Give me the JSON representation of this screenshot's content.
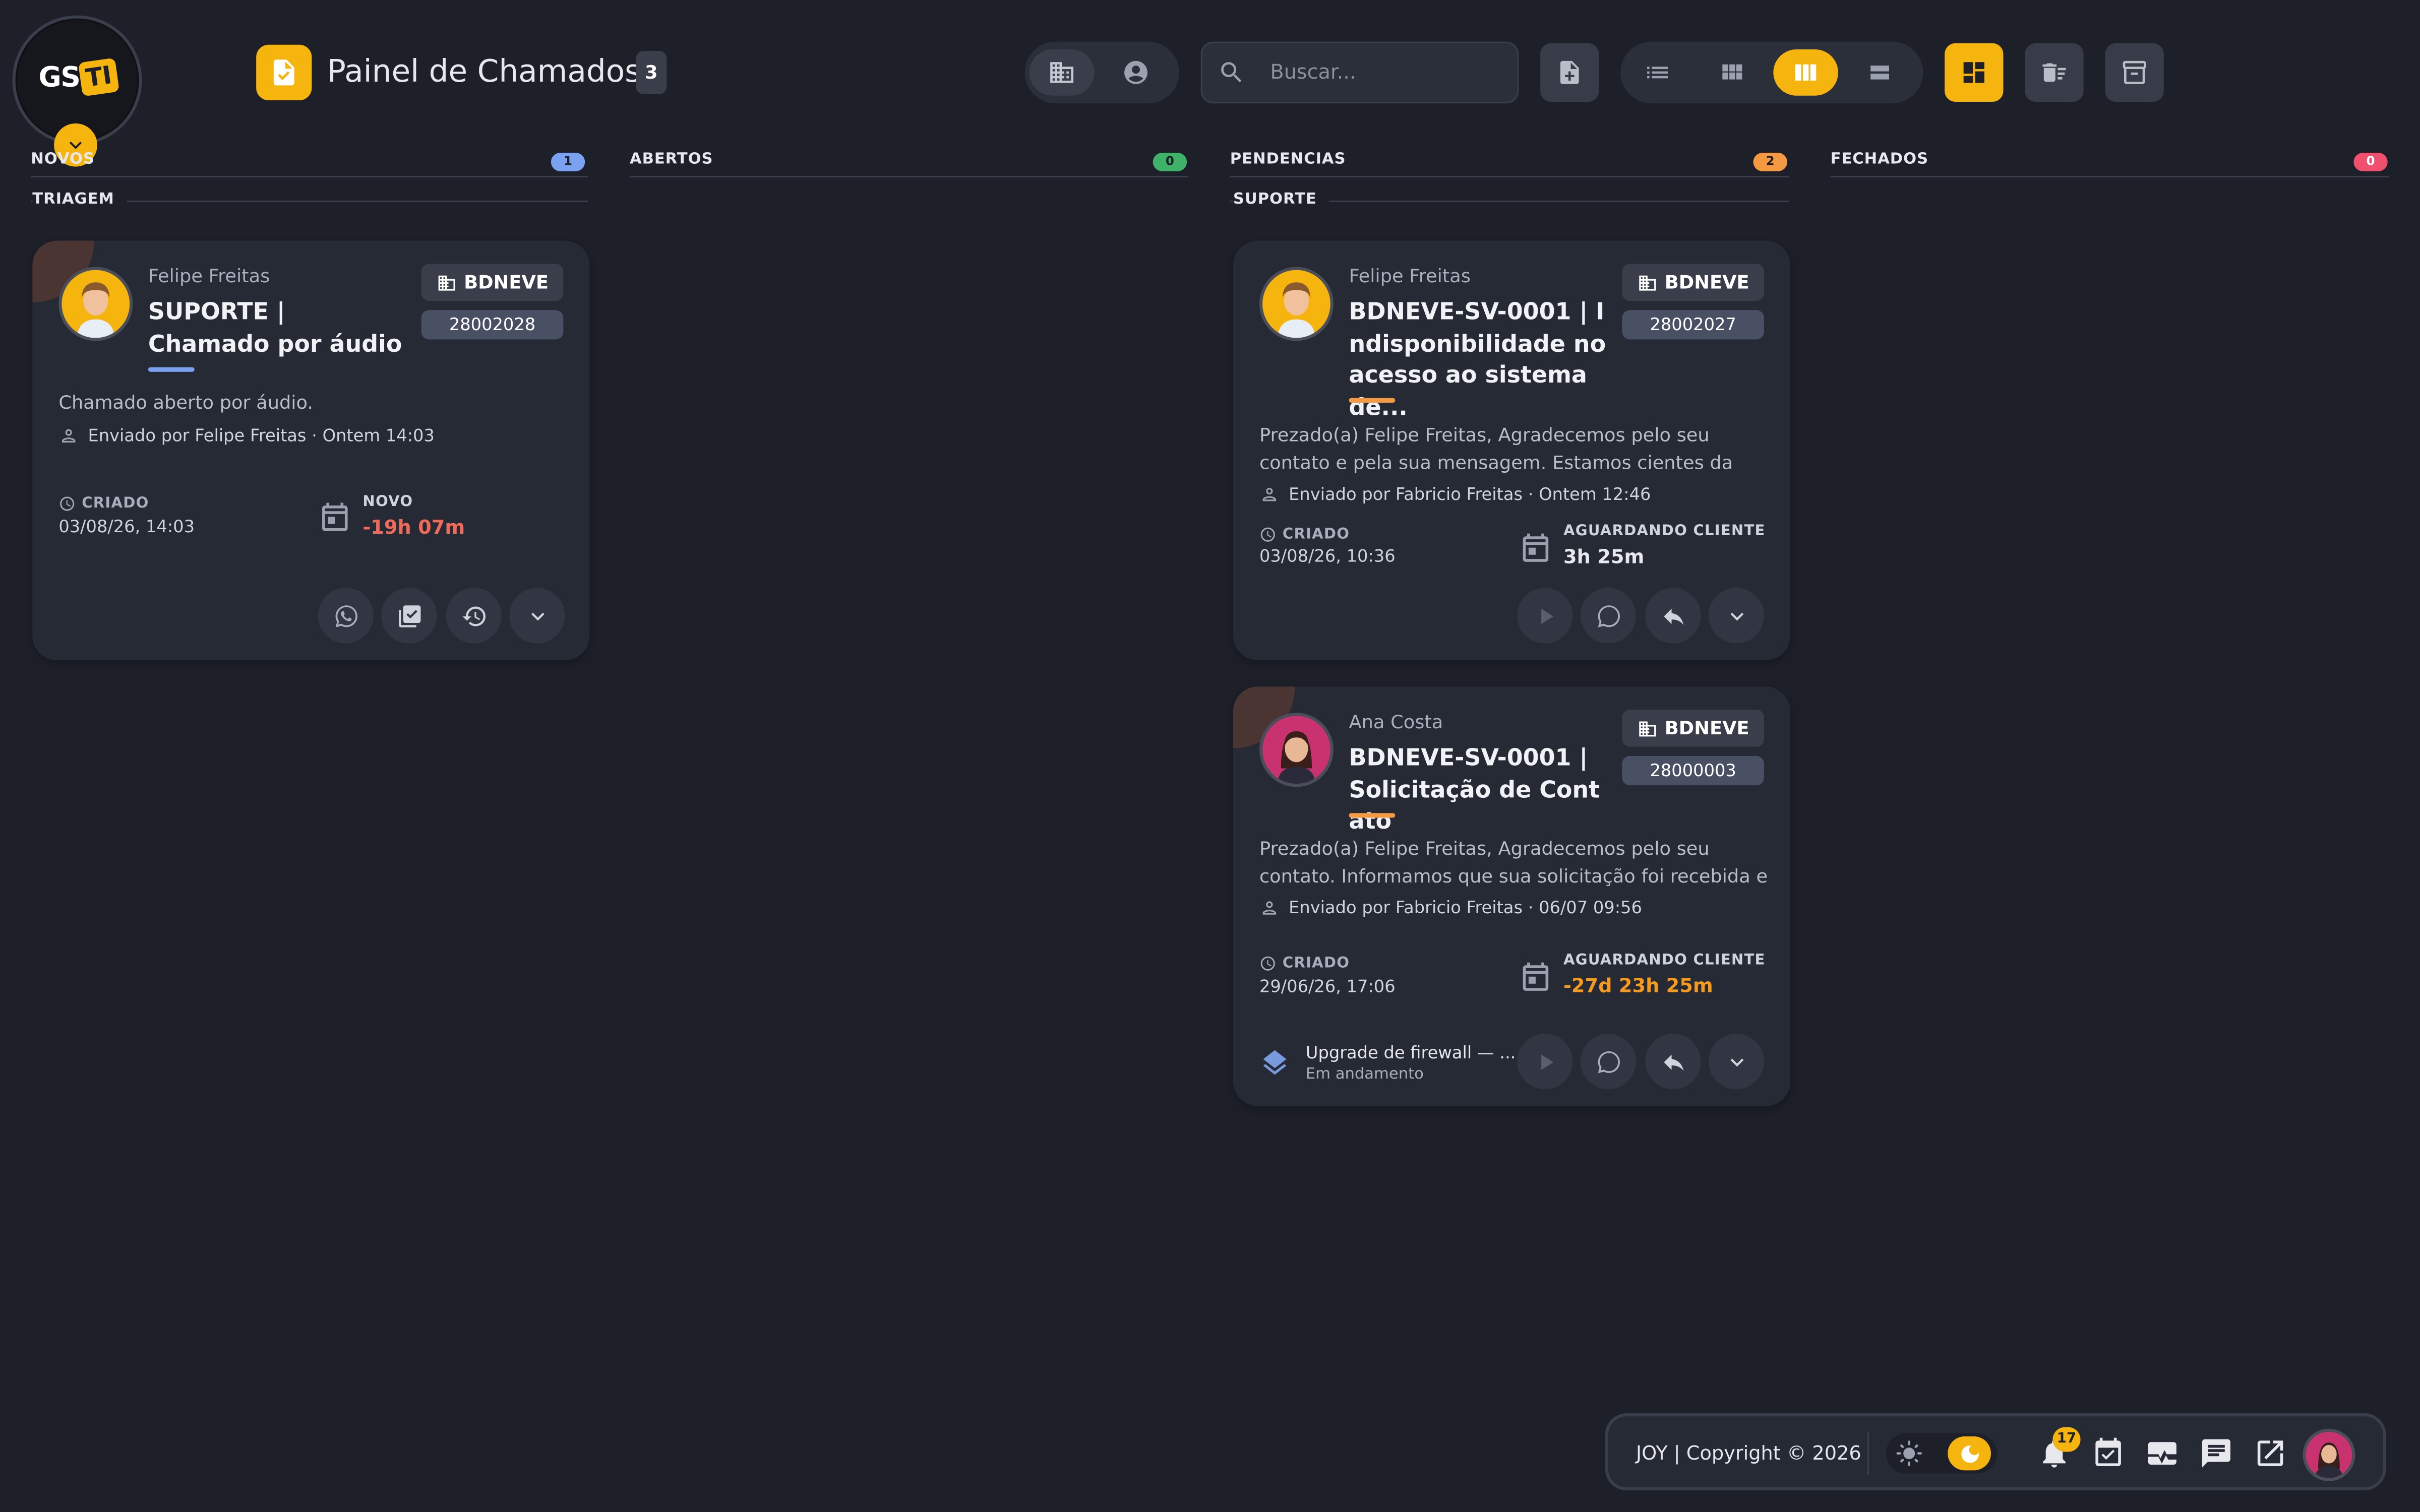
{
  "logo": {
    "gs": "GS",
    "ti": "TI"
  },
  "header": {
    "title": "Painel de Chamados",
    "count": "3"
  },
  "search": {
    "placeholder": "Buscar..."
  },
  "colors": {
    "accent": "#f5b50e",
    "blue": "#7aa2f0",
    "green": "#3fb26a",
    "orange": "#f59a42",
    "red": "#f0506e"
  },
  "columns": [
    {
      "name": "NOVOS",
      "count": "1",
      "color": "#7aa2f0",
      "group": "TRIAGEM"
    },
    {
      "name": "ABERTOS",
      "count": "0",
      "color": "#3fb26a",
      "group": ""
    },
    {
      "name": "PENDENCIAS",
      "count": "2",
      "color": "#f59a42",
      "group": "SUPORTE"
    },
    {
      "name": "FECHADOS",
      "count": "0",
      "color": "#f0506e",
      "group": ""
    }
  ],
  "cards": [
    {
      "requester": "Felipe Freitas",
      "title": "SUPORTE | Chamado por áudio",
      "company": "BDNEVE",
      "code": "28002028",
      "message": "Chamado aberto por áudio.",
      "sender": "Enviado por Felipe Freitas · Ontem 14:03",
      "created_label": "CRIADO",
      "created_at": "03/08/26, 14:03",
      "status_label": "NOVO",
      "status_time": "-19h 07m",
      "status_color": "#f06a5a",
      "underline_color": "#7aa2f0"
    },
    {
      "requester": "Felipe Freitas",
      "title": "BDNEVE-SV-0001 | Indisponibilidade no acesso ao sistema de...",
      "company": "BDNEVE",
      "code": "28002027",
      "message": "Prezado(a) Felipe Freitas, Agradecemos pelo seu contato e pela sua mensagem. Estamos cientes da indisponibilidad...",
      "sender": "Enviado por Fabricio Freitas · Ontem 12:46",
      "created_label": "CRIADO",
      "created_at": "03/08/26, 10:36",
      "status_label": "AGUARDANDO CLIENTE",
      "status_time": "3h 25m",
      "status_color": "#e6e8ee",
      "underline_color": "#f59a42"
    },
    {
      "requester": "Ana Costa",
      "title": "BDNEVE-SV-0001 | Solicitação de Contato",
      "company": "BDNEVE",
      "code": "28000003",
      "message": "Prezado(a) Felipe Freitas, Agradecemos pelo seu contato. Informamos que sua solicitação foi recebida e estamos à...",
      "sender": "Enviado por Fabricio Freitas · 06/07 09:56",
      "created_label": "CRIADO",
      "created_at": "29/06/26, 17:06",
      "status_label": "AGUARDANDO CLIENTE",
      "status_time": "-27d 23h 25m",
      "status_color": "#f59a1a",
      "underline_color": "#f59a42",
      "project_name": "Upgrade de firewall — ...",
      "project_status": "Em andamento"
    }
  ],
  "footer": {
    "copyright": "JOY | Copyright © 2026",
    "notifications": "17"
  }
}
